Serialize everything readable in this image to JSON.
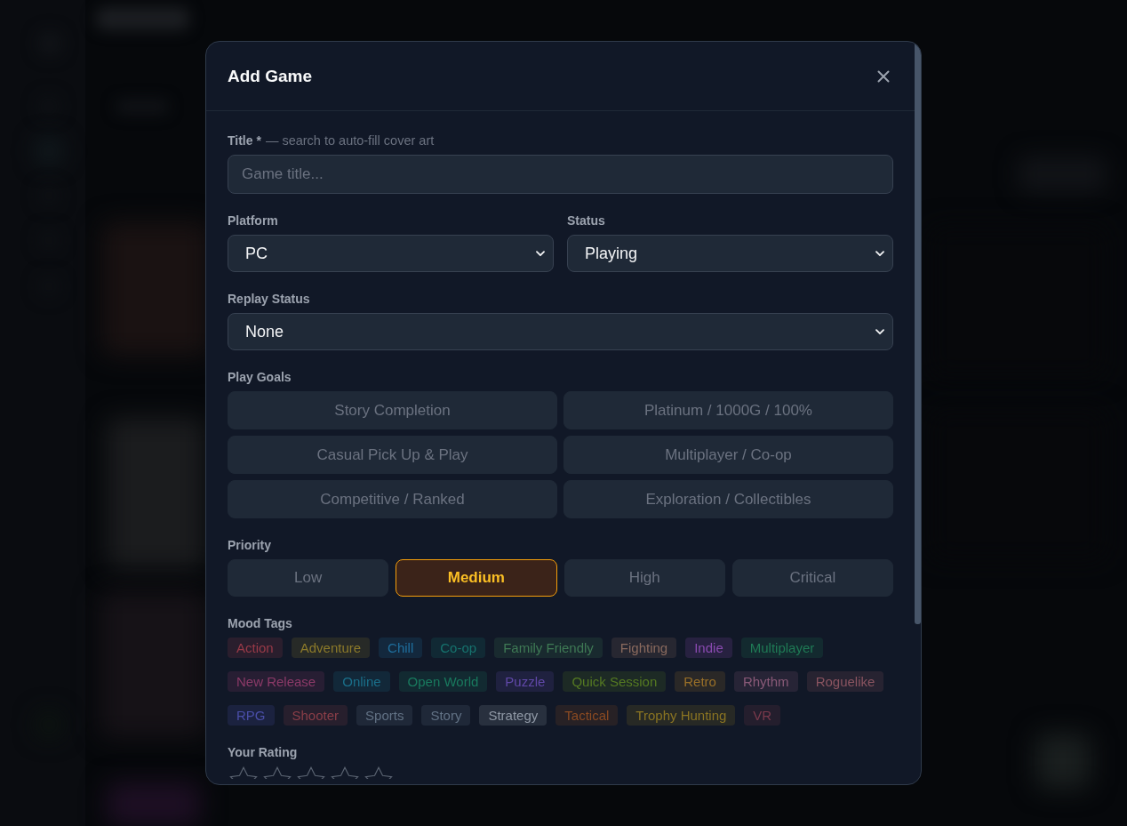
{
  "modal": {
    "title": "Add Game"
  },
  "title_field": {
    "label": "Title *",
    "hint": "— search to auto-fill cover art",
    "placeholder": "Game title..."
  },
  "platform": {
    "label": "Platform",
    "value": "PC"
  },
  "status": {
    "label": "Status",
    "value": "Playing"
  },
  "replay_status": {
    "label": "Replay Status",
    "value": "None"
  },
  "play_goals": {
    "label": "Play Goals",
    "options": [
      {
        "label": "Story Completion",
        "selected": false
      },
      {
        "label": "Platinum / 1000G / 100%",
        "selected": false
      },
      {
        "label": "Casual Pick Up & Play",
        "selected": false
      },
      {
        "label": "Multiplayer / Co-op",
        "selected": false
      },
      {
        "label": "Competitive / Ranked",
        "selected": false
      },
      {
        "label": "Exploration / Collectibles",
        "selected": false
      }
    ]
  },
  "priority": {
    "label": "Priority",
    "options": [
      {
        "label": "Low",
        "selected": false
      },
      {
        "label": "Medium",
        "selected": true
      },
      {
        "label": "High",
        "selected": false
      },
      {
        "label": "Critical",
        "selected": false
      }
    ]
  },
  "mood_tags": {
    "label": "Mood Tags",
    "tags": [
      {
        "label": "Action",
        "color": "#993a48",
        "selected": false
      },
      {
        "label": "Adventure",
        "color": "#8c7a2a",
        "selected": false
      },
      {
        "label": "Chill",
        "color": "#1f6f9e",
        "selected": false
      },
      {
        "label": "Co-op",
        "color": "#16736e",
        "selected": false
      },
      {
        "label": "Family Friendly",
        "color": "#3f7a55",
        "selected": false
      },
      {
        "label": "Fighting",
        "color": "#8a6a5e",
        "selected": false
      },
      {
        "label": "Indie",
        "color": "#8a4ab0",
        "selected": false
      },
      {
        "label": "Multiplayer",
        "color": "#1f7a55",
        "selected": false
      },
      {
        "label": "New Release",
        "color": "#8c3a68",
        "selected": false
      },
      {
        "label": "Online",
        "color": "#1a6f8a",
        "selected": false
      },
      {
        "label": "Open World",
        "color": "#197a5e",
        "selected": false
      },
      {
        "label": "Puzzle",
        "color": "#6048a8",
        "selected": false
      },
      {
        "label": "Quick Session",
        "color": "#557a22",
        "selected": false
      },
      {
        "label": "Retro",
        "color": "#9a7028",
        "selected": false
      },
      {
        "label": "Rhythm",
        "color": "#8a5a78",
        "selected": false
      },
      {
        "label": "Roguelike",
        "color": "#8a5460",
        "selected": false
      },
      {
        "label": "RPG",
        "color": "#4a4ea8",
        "selected": false
      },
      {
        "label": "Shooter",
        "color": "#8a3e48",
        "selected": false
      },
      {
        "label": "Sports",
        "color": "#627285",
        "selected": false
      },
      {
        "label": "Story",
        "color": "#627285",
        "selected": false
      },
      {
        "label": "Strategy",
        "color": "#8f98a5",
        "selected": false
      },
      {
        "label": "Tactical",
        "color": "#8a4a22",
        "selected": false
      },
      {
        "label": "Trophy Hunting",
        "color": "#8a7422",
        "selected": false
      },
      {
        "label": "VR",
        "color": "#7a3a4c",
        "selected": false
      }
    ]
  },
  "rating": {
    "label": "Your Rating",
    "stars": 0
  }
}
